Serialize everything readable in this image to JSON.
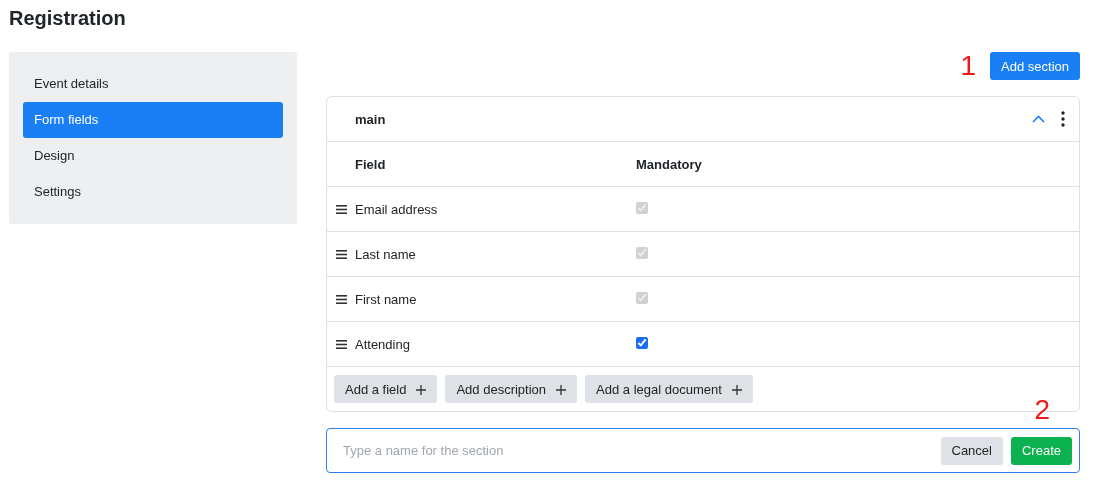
{
  "page": {
    "title": "Registration"
  },
  "sidebar": {
    "items": [
      {
        "label": "Event details",
        "selected": false
      },
      {
        "label": "Form fields",
        "selected": true
      },
      {
        "label": "Design",
        "selected": false
      },
      {
        "label": "Settings",
        "selected": false
      }
    ]
  },
  "toolbar": {
    "marker": "1",
    "button": "Add section"
  },
  "section": {
    "name": "main",
    "expanded": true,
    "columns": [
      "Field",
      "Mandatory"
    ],
    "rows": [
      {
        "field": "Email address",
        "mandatory": true,
        "disabled": true
      },
      {
        "field": "Last name",
        "mandatory": true,
        "disabled": true
      },
      {
        "field": "First name",
        "mandatory": true,
        "disabled": true
      },
      {
        "field": "Attending",
        "mandatory": true,
        "disabled": false
      }
    ],
    "actions": [
      "Add a field",
      "Add description",
      "Add a legal document"
    ]
  },
  "new_section": {
    "marker": "2",
    "placeholder": "Type a name for the section",
    "buttons": [
      {
        "label": "Cancel",
        "kind": "secondary"
      },
      {
        "label": "Create",
        "kind": "primary"
      }
    ]
  }
}
